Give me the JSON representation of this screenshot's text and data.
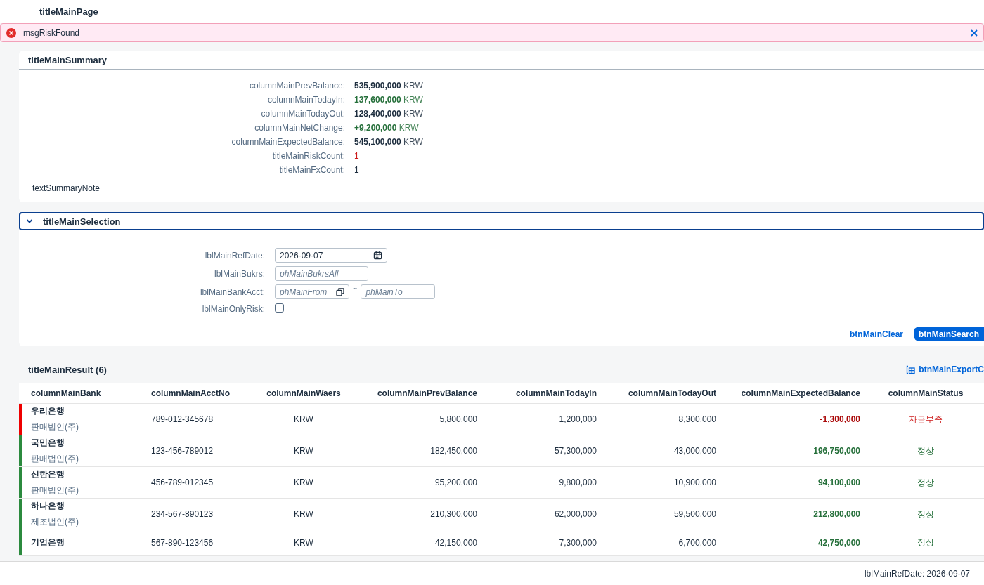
{
  "page": {
    "title": "titleMainPage"
  },
  "message": {
    "text": "msgRiskFound"
  },
  "summary": {
    "title": "titleMainSummary",
    "items": [
      {
        "label": "columnMainPrevBalance:",
        "value": "535,900,000",
        "unit": "KRW",
        "color": "#1d2d3e",
        "bold": true
      },
      {
        "label": "columnMainTodayIn:",
        "value": "137,600,000",
        "unit": "KRW",
        "color": "#256f3a",
        "bold": true
      },
      {
        "label": "columnMainTodayOut:",
        "value": "128,400,000",
        "unit": "KRW",
        "color": "#1d2d3e",
        "bold": true
      },
      {
        "label": "columnMainNetChange:",
        "value": "+9,200,000",
        "unit": "KRW",
        "color": "#256f3a",
        "bold": true
      },
      {
        "label": "columnMainExpectedBalance:",
        "value": "545,100,000",
        "unit": "KRW",
        "color": "#1d2d3e",
        "bold": true
      },
      {
        "label": "titleMainRiskCount:",
        "value": "1",
        "color": "#cc1919",
        "bold": false
      },
      {
        "label": "titleMainFxCount:",
        "value": "1",
        "color": "#1d2d3e",
        "bold": false
      }
    ],
    "note": "textSummaryNote"
  },
  "selection": {
    "title": "titleMainSelection",
    "expanded": true,
    "fields": [
      {
        "kind": "date",
        "label": "lblMainRefDate:",
        "value": "2026-09-07"
      },
      {
        "kind": "input",
        "label": "lblMainBukrs:",
        "placeholder": "phMainBukrsAll"
      },
      {
        "kind": "range",
        "label": "lblMainBankAcct:",
        "placeholder": "phMainFrom",
        "separator": "~",
        "placeholder_to": "phMainTo"
      },
      {
        "kind": "checkbox",
        "label": "lblMainOnlyRisk:",
        "checked": false
      }
    ],
    "buttons": [
      {
        "label": "btnMainClear",
        "kind": "ghost"
      },
      {
        "label": "btnMainSearch",
        "kind": "primary"
      }
    ]
  },
  "result": {
    "title": "titleMainResult (6)",
    "export": "btnMainExportC",
    "columns": [
      "columnMainBank",
      "columnMainAcctNo",
      "columnMainWaers",
      "columnMainPrevBalance",
      "columnMainTodayIn",
      "columnMainTodayOut",
      "columnMainExpectedBalance",
      "columnMainStatus"
    ],
    "rows": [
      {
        "color": "#ee0000",
        "risk": true,
        "bank": "우리은행",
        "company": "판매법인(주)",
        "acct": "789-012-345678",
        "waers": "KRW",
        "prev": "5,800,000",
        "in": "1,200,000",
        "out": "8,300,000",
        "expected": "-1,300,000",
        "status": "자금부족"
      },
      {
        "color": "#2b8a3e",
        "risk": false,
        "bank": "국민은행",
        "company": "판매법인(주)",
        "acct": "123-456-789012",
        "waers": "KRW",
        "prev": "182,450,000",
        "in": "57,300,000",
        "out": "43,000,000",
        "expected": "196,750,000",
        "status": "정상"
      },
      {
        "color": "#2b8a3e",
        "risk": false,
        "bank": "신한은행",
        "company": "판매법인(주)",
        "acct": "456-789-012345",
        "waers": "KRW",
        "prev": "95,200,000",
        "in": "9,800,000",
        "out": "10,900,000",
        "expected": "94,100,000",
        "status": "정상"
      },
      {
        "color": "#2b8a3e",
        "risk": false,
        "bank": "하나은행",
        "company": "제조법인(주)",
        "acct": "234-567-890123",
        "waers": "KRW",
        "prev": "210,300,000",
        "in": "62,000,000",
        "out": "59,500,000",
        "expected": "212,800,000",
        "status": "정상"
      },
      {
        "color": "#2b8a3e",
        "risk": false,
        "bank": "기업은행",
        "acct": "567-890-123456",
        "waers": "KRW",
        "prev": "42,150,000",
        "in": "7,300,000",
        "out": "6,700,000",
        "expected": "42,750,000",
        "status": "정상"
      }
    ]
  },
  "footer": {
    "text": "lblMainRefDate: 2026-09-07"
  }
}
